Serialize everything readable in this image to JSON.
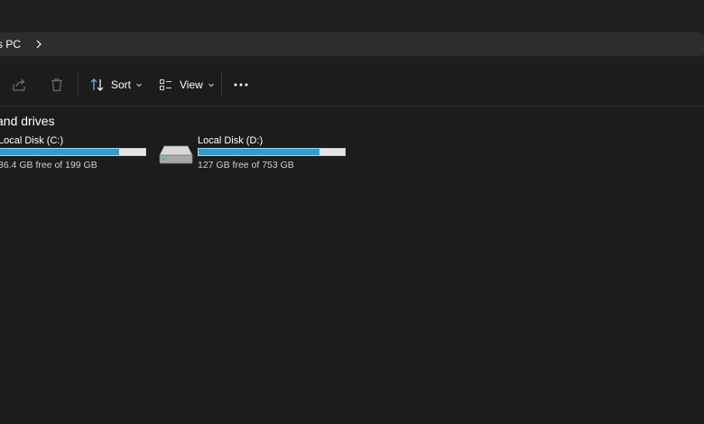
{
  "address": {
    "breadcrumb": "s PC",
    "chevron_icon": "chevron-right-icon"
  },
  "toolbar": {
    "share_icon": "share-icon",
    "delete_icon": "trash-icon",
    "sort_label": "Sort",
    "view_label": "View",
    "more_icon": "more-icon"
  },
  "section": {
    "title": "and drives"
  },
  "drives": [
    {
      "name": "Local Disk (C:)",
      "free_text": "36.4 GB free of 199 GB",
      "used_fraction": 0.82,
      "icon": "hard-drive-icon"
    },
    {
      "name": "Local Disk (D:)",
      "free_text": "127 GB free of 753 GB",
      "used_fraction": 0.83,
      "icon": "hard-drive-icon"
    }
  ],
  "colors": {
    "background": "#1c1c1c",
    "accent_bar": "#26a0da",
    "bar_track": "#e6e6e6"
  }
}
